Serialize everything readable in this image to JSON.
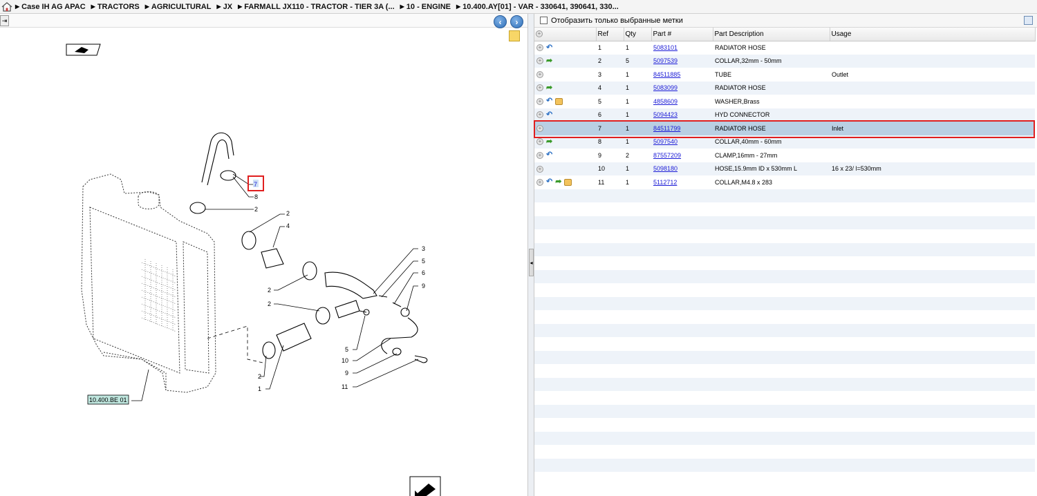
{
  "breadcrumb": [
    "Case IH AG APAC",
    "TRACTORS",
    "AGRICULTURAL",
    "JX",
    "FARMALL JX110 - TRACTOR - TIER 3A (...",
    "10 - ENGINE",
    "10.400.AY[01] - VAR - 330641, 390641, 330..."
  ],
  "filter": {
    "label": "Отобразить только выбранные метки"
  },
  "table": {
    "headers": [
      "Ref",
      "Qty",
      "Part #",
      "Part Description",
      "Usage"
    ],
    "rows": [
      {
        "ref": "1",
        "qty": "1",
        "part": "5083101",
        "desc": "RADIATOR HOSE",
        "usage": "",
        "icons": [
          "back-arrow"
        ]
      },
      {
        "ref": "2",
        "qty": "5",
        "part": "5097539",
        "desc": "COLLAR,32mm - 50mm",
        "usage": "",
        "icons": [
          "forward-arrow"
        ]
      },
      {
        "ref": "3",
        "qty": "1",
        "part": "84511885",
        "desc": "TUBE",
        "usage": "Outlet",
        "icons": []
      },
      {
        "ref": "4",
        "qty": "1",
        "part": "5083099",
        "desc": "RADIATOR HOSE",
        "usage": "",
        "icons": [
          "forward-arrow"
        ]
      },
      {
        "ref": "5",
        "qty": "1",
        "part": "4858609",
        "desc": "WASHER,Brass",
        "usage": "",
        "icons": [
          "back-arrow",
          "package"
        ]
      },
      {
        "ref": "6",
        "qty": "1",
        "part": "5094423",
        "desc": "HYD CONNECTOR",
        "usage": "",
        "icons": [
          "back-arrow"
        ]
      },
      {
        "ref": "7",
        "qty": "1",
        "part": "84511799",
        "desc": "RADIATOR HOSE",
        "usage": "Inlet",
        "icons": [],
        "selected": true
      },
      {
        "ref": "8",
        "qty": "1",
        "part": "5097540",
        "desc": "COLLAR,40mm - 60mm",
        "usage": "",
        "icons": [
          "forward-arrow"
        ]
      },
      {
        "ref": "9",
        "qty": "2",
        "part": "87557209",
        "desc": "CLAMP,16mm - 27mm",
        "usage": "",
        "icons": [
          "back-arrow"
        ]
      },
      {
        "ref": "10",
        "qty": "1",
        "part": "5098180",
        "desc": "HOSE,15.9mm ID x 530mm L",
        "usage": "16 x 23/ l=530mm",
        "icons": []
      },
      {
        "ref": "11",
        "qty": "1",
        "part": "5112712",
        "desc": "COLLAR,M4.8 x 283",
        "usage": "",
        "icons": [
          "back-arrow",
          "forward-arrow",
          "package"
        ]
      }
    ]
  },
  "diagram": {
    "callouts": [
      "1",
      "2",
      "2",
      "2",
      "2",
      "2",
      "3",
      "4",
      "5",
      "5",
      "6",
      "7",
      "8",
      "9",
      "9",
      "10",
      "11"
    ],
    "reference_label": "10.400.BE 01"
  },
  "colors": {
    "selected_row": "#b9cfe3",
    "highlight_outline": "#e01e1e",
    "link": "#1a1ad6"
  }
}
